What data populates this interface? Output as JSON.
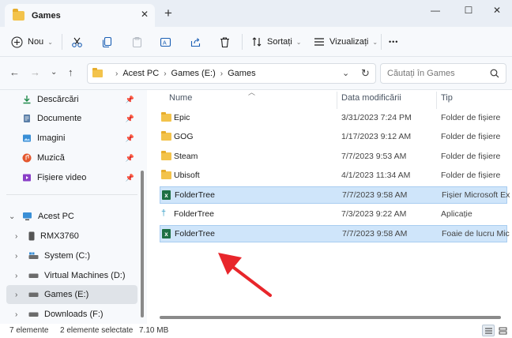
{
  "window": {
    "tab_title": "Games",
    "new_tab_symbol": "+",
    "minimize_symbol": "—",
    "maximize_symbol": "☐",
    "close_symbol": "✕"
  },
  "toolbar": {
    "new_label": "Nou",
    "sort_label": "Sortați",
    "view_label": "Vizualizați",
    "more_label": "•••"
  },
  "address": {
    "crumbs": [
      "Acest PC",
      "Games (E:)",
      "Games"
    ],
    "search_placeholder": "Căutați în Games"
  },
  "sidebar": {
    "quick_access": [
      {
        "label": "Descărcări",
        "icon": "download-icon"
      },
      {
        "label": "Documente",
        "icon": "document-icon"
      },
      {
        "label": "Imagini",
        "icon": "image-icon"
      },
      {
        "label": "Muzică",
        "icon": "music-icon"
      },
      {
        "label": "Fișiere video",
        "icon": "video-icon"
      }
    ],
    "this_pc": "Acest PC",
    "drives": [
      {
        "label": "RMX3760",
        "icon": "phone-icon"
      },
      {
        "label": "System (C:)",
        "icon": "drive-icon"
      },
      {
        "label": "Virtual Machines (D:)",
        "icon": "drive-icon"
      },
      {
        "label": "Games (E:)",
        "icon": "drive-icon",
        "selected": true
      },
      {
        "label": "Downloads (F:)",
        "icon": "drive-icon"
      }
    ]
  },
  "files": {
    "columns": [
      "Nume",
      "Data modificării",
      "Tip"
    ],
    "rows": [
      {
        "name": "Epic",
        "date": "3/31/2023 7:24 PM",
        "type": "Folder de fișiere",
        "icon": "folder",
        "selected": false
      },
      {
        "name": "GOG",
        "date": "1/17/2023 9:12 AM",
        "type": "Folder de fișiere",
        "icon": "folder",
        "selected": false
      },
      {
        "name": "Steam",
        "date": "7/7/2023 9:53 AM",
        "type": "Folder de fișiere",
        "icon": "folder",
        "selected": false
      },
      {
        "name": "Ubisoft",
        "date": "4/1/2023 11:34 AM",
        "type": "Folder de fișiere",
        "icon": "folder",
        "selected": false
      },
      {
        "name": "FolderTree",
        "date": "7/7/2023 9:58 AM",
        "type": "Fișier Microsoft Excel",
        "icon": "excel",
        "selected": true
      },
      {
        "name": "FolderTree",
        "date": "7/3/2023 9:22 AM",
        "type": "Aplicație",
        "icon": "app",
        "selected": false
      },
      {
        "name": "FolderTree",
        "date": "7/7/2023 9:58 AM",
        "type": "Foaie de lucru Micros...",
        "icon": "excel",
        "selected": true
      }
    ]
  },
  "status": {
    "count": "7 elemente",
    "selection": "2 elemente selectate",
    "size": "7.10 MB"
  },
  "colors": {
    "accent": "#0067c0",
    "selection_bg": "#cfe5fa",
    "annotation_arrow": "#e8262b"
  }
}
